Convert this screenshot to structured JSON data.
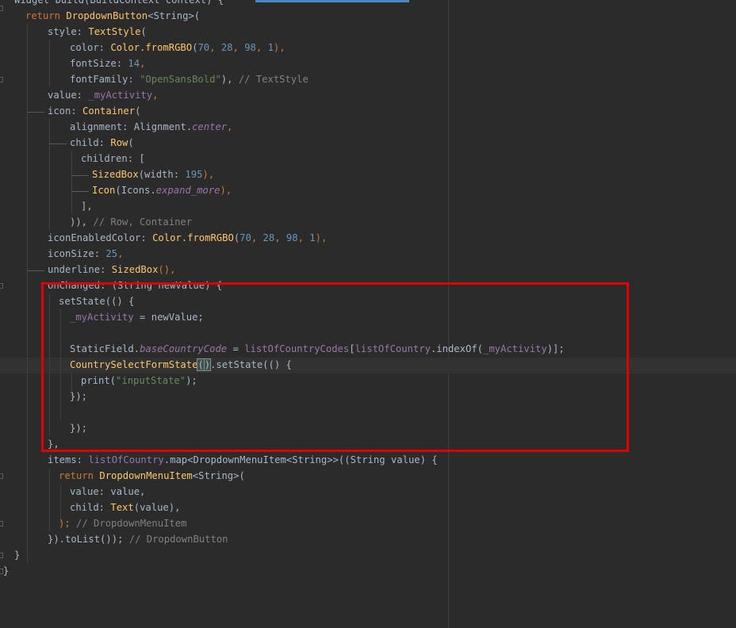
{
  "editor": {
    "accent_color": "#4a88c7",
    "highlight_color": "#e00000",
    "background": "#2b2b2b"
  },
  "lines": [
    [
      {
        "t": "Widget build(BuildContext context) {",
        "c": "plain"
      }
    ],
    [
      {
        "t": "return ",
        "c": "kw"
      },
      {
        "t": "DropdownButton",
        "c": "cls"
      },
      {
        "t": "<String>(",
        "c": "plain"
      }
    ],
    [
      {
        "t": "style: ",
        "c": "plain"
      },
      {
        "t": "TextStyle",
        "c": "cls"
      },
      {
        "t": "(",
        "c": "plain"
      }
    ],
    [
      {
        "t": "color: ",
        "c": "plain"
      },
      {
        "t": "Color.",
        "c": "cls"
      },
      {
        "t": "fromRGBO",
        "c": "cls"
      },
      {
        "t": "(",
        "c": "plain"
      },
      {
        "t": "70",
        "c": "num"
      },
      {
        "t": ", ",
        "c": "kw"
      },
      {
        "t": "28",
        "c": "num"
      },
      {
        "t": ", ",
        "c": "kw"
      },
      {
        "t": "98",
        "c": "num"
      },
      {
        "t": ", ",
        "c": "kw"
      },
      {
        "t": "1",
        "c": "num"
      },
      {
        "t": "),",
        "c": "kw"
      }
    ],
    [
      {
        "t": "fontSize: ",
        "c": "plain"
      },
      {
        "t": "14",
        "c": "num"
      },
      {
        "t": ",",
        "c": "kw"
      }
    ],
    [
      {
        "t": "fontFamily: ",
        "c": "plain"
      },
      {
        "t": "\"OpenSansBold\"",
        "c": "str"
      },
      {
        "t": "), ",
        "c": "plain"
      },
      {
        "t": "// TextStyle",
        "c": "cmt"
      }
    ],
    [
      {
        "t": "value: ",
        "c": "plain"
      },
      {
        "t": "_myActivity",
        "c": "var"
      },
      {
        "t": ",",
        "c": "kw"
      }
    ],
    [
      {
        "t": "icon: ",
        "c": "plain"
      },
      {
        "t": "Container",
        "c": "cls"
      },
      {
        "t": "(",
        "c": "plain"
      }
    ],
    [
      {
        "t": "alignment: Alignment.",
        "c": "plain"
      },
      {
        "t": "center",
        "c": "ital"
      },
      {
        "t": ",",
        "c": "kw"
      }
    ],
    [
      {
        "t": "child: ",
        "c": "plain"
      },
      {
        "t": "Row",
        "c": "cls"
      },
      {
        "t": "(",
        "c": "plain"
      }
    ],
    [
      {
        "t": "children: [",
        "c": "plain"
      }
    ],
    [
      {
        "t": "SizedBox",
        "c": "cls"
      },
      {
        "t": "(width: ",
        "c": "plain"
      },
      {
        "t": "195",
        "c": "num"
      },
      {
        "t": "),",
        "c": "kw"
      }
    ],
    [
      {
        "t": "Icon",
        "c": "cls"
      },
      {
        "t": "(Icons.",
        "c": "plain"
      },
      {
        "t": "expand_more",
        "c": "ital"
      },
      {
        "t": "),",
        "c": "kw"
      }
    ],
    [
      {
        "t": "],",
        "c": "plain"
      }
    ],
    [
      {
        "t": ")), ",
        "c": "plain"
      },
      {
        "t": "// Row, Container",
        "c": "cmt"
      }
    ],
    [
      {
        "t": "iconEnabledColor: ",
        "c": "plain"
      },
      {
        "t": "Color.",
        "c": "cls"
      },
      {
        "t": "fromRGBO",
        "c": "cls"
      },
      {
        "t": "(",
        "c": "plain"
      },
      {
        "t": "70",
        "c": "num"
      },
      {
        "t": ", ",
        "c": "kw"
      },
      {
        "t": "28",
        "c": "num"
      },
      {
        "t": ", ",
        "c": "kw"
      },
      {
        "t": "98",
        "c": "num"
      },
      {
        "t": ", ",
        "c": "kw"
      },
      {
        "t": "1",
        "c": "num"
      },
      {
        "t": "),",
        "c": "kw"
      }
    ],
    [
      {
        "t": "iconSize: ",
        "c": "plain"
      },
      {
        "t": "25",
        "c": "num"
      },
      {
        "t": ",",
        "c": "kw"
      }
    ],
    [
      {
        "t": "underline: ",
        "c": "plain"
      },
      {
        "t": "SizedBox",
        "c": "cls"
      },
      {
        "t": "(),",
        "c": "kw"
      }
    ],
    [
      {
        "t": "onChanged: (String newValue) {",
        "c": "plain"
      }
    ],
    [
      {
        "t": "setState",
        "c": "plain"
      },
      {
        "t": "(() {",
        "c": "plain"
      }
    ],
    [
      {
        "t": "_myActivity",
        "c": "var"
      },
      {
        "t": " = newValue;",
        "c": "plain"
      }
    ],
    [],
    [
      {
        "t": "StaticField.",
        "c": "plain"
      },
      {
        "t": "baseCountryCode",
        "c": "ital"
      },
      {
        "t": " = ",
        "c": "plain"
      },
      {
        "t": "listOfCountryCodes",
        "c": "var"
      },
      {
        "t": "[",
        "c": "plain"
      },
      {
        "t": "listOfCountry",
        "c": "var"
      },
      {
        "t": ".indexOf(",
        "c": "plain"
      },
      {
        "t": "_myActivity",
        "c": "var"
      },
      {
        "t": ")];",
        "c": "plain"
      }
    ],
    [
      {
        "t": "CountrySelectFormState",
        "c": "cls"
      },
      {
        "t": "BRACKET",
        "c": "bracket"
      },
      {
        "t": ".setState(() {",
        "c": "plain"
      }
    ],
    [
      {
        "t": "print(",
        "c": "plain"
      },
      {
        "t": "\"inputState\"",
        "c": "str"
      },
      {
        "t": ");",
        "c": "plain"
      }
    ],
    [
      {
        "t": "});",
        "c": "plain"
      }
    ],
    [],
    [
      {
        "t": "});",
        "c": "plain"
      }
    ],
    [
      {
        "t": "},",
        "c": "plain"
      }
    ],
    [
      {
        "t": "items: ",
        "c": "plain"
      },
      {
        "t": "listOfCountry",
        "c": "var"
      },
      {
        "t": ".map<DropdownMenuItem<String>>((String value) {",
        "c": "plain"
      }
    ],
    [
      {
        "t": "return ",
        "c": "kw"
      },
      {
        "t": "DropdownMenuItem",
        "c": "cls"
      },
      {
        "t": "<String>(",
        "c": "plain"
      }
    ],
    [
      {
        "t": "value: value,",
        "c": "plain"
      }
    ],
    [
      {
        "t": "child: ",
        "c": "plain"
      },
      {
        "t": "Text",
        "c": "cls"
      },
      {
        "t": "(value),",
        "c": "plain"
      }
    ],
    [
      {
        "t": "); ",
        "c": "kw"
      },
      {
        "t": "// DropdownMenuItem",
        "c": "cmt"
      }
    ],
    [
      {
        "t": "}).toList()); ",
        "c": "plain"
      },
      {
        "t": "// DropdownButton",
        "c": "cmt"
      }
    ],
    [
      {
        "t": "}",
        "c": "plain"
      }
    ],
    [
      {
        "t": "}",
        "c": "plain"
      }
    ]
  ]
}
